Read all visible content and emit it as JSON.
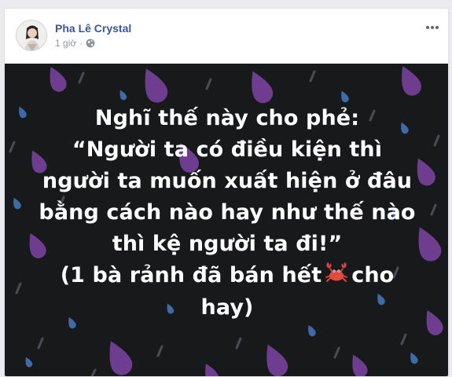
{
  "post": {
    "author_name": "Pha Lê Crystal",
    "timestamp": "1 giờ",
    "separator": "·",
    "audience_icon": "globe-icon",
    "more_icon": "more-options-icon",
    "avatar_icon": "profile-photo",
    "lines": [
      "Nghĩ thế này cho phẻ:",
      "“Người ta có điều kiện thì",
      "người ta muốn xuất hiện ở đâu",
      "bằng cách nào hay như thế nào",
      "thì kệ người ta đi!”",
      "hay)"
    ],
    "line6_before": "(1 bà rảnh đã bán hết",
    "line6_after": "cho",
    "emoji_icon": "crab-emoji-icon"
  },
  "colors": {
    "name": "#385898",
    "meta": "#90949c",
    "background": "#18191a",
    "drop_purple": "#6f3d8f",
    "drop_blue": "#3f6aa8",
    "drop_grey": "#4a4c55"
  }
}
